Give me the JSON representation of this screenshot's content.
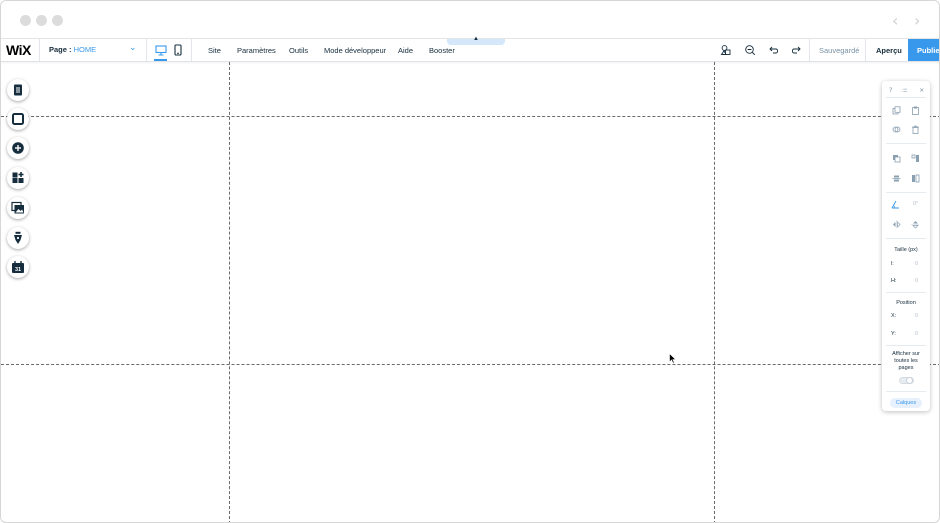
{
  "topbar": {
    "logo": "WiX",
    "page_label": "Page :",
    "page_value": "HOME",
    "menu": [
      "Site",
      "Paramètres",
      "Outils",
      "Mode développeur",
      "Aide",
      "Booster"
    ],
    "saved_label": "Sauvegardé",
    "preview_label": "Aperçu",
    "publish_label": "Publier"
  },
  "left_toolbar": {
    "icons": [
      "pages-icon",
      "background-icon",
      "add-icon",
      "apps-icon",
      "media-icon",
      "blog-icon",
      "bookings-icon"
    ],
    "booking_badge": "31"
  },
  "panel": {
    "help": "?",
    "drag": "::::",
    "close": "×",
    "rotation_value": "0°",
    "size_title": "Taille (px)",
    "width_key": "l:",
    "width_value": "0",
    "height_key": "H:",
    "height_value": "0",
    "position_title": "Position",
    "x_key": "X:",
    "x_value": "0",
    "y_key": "Y:",
    "y_value": "0",
    "show_all_pages": "Afficher sur toutes les pages",
    "layers_label": "Calques"
  },
  "colors": {
    "accent": "#3899ec",
    "text": "#162d3d",
    "muted": "#7a92a5"
  }
}
